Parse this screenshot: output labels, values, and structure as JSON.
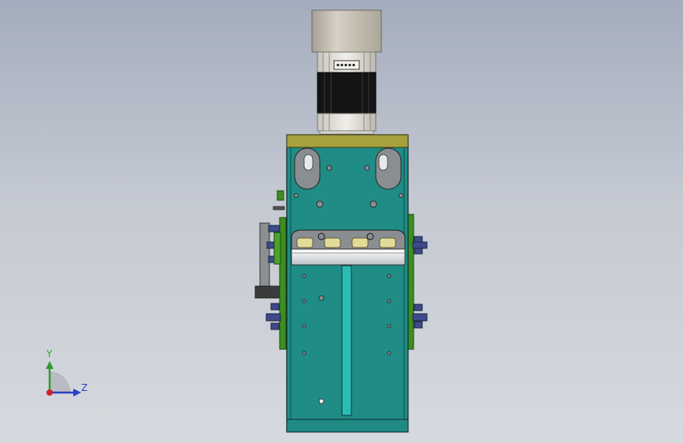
{
  "triad": {
    "y_label": "Y",
    "z_label": "Z",
    "x_color": "#d0202a",
    "y_color": "#2f9b2f",
    "z_color": "#2a3fc8"
  },
  "model": {
    "plate_color": "#208c86",
    "rail_color": "#3d8f1f",
    "top_plate_color": "#a6a13c",
    "motor_cap_color": "#c8c0b4",
    "motor_body_color": "#151515",
    "bearing_color": "#e3db98",
    "slot_color": "#2cbcb4"
  }
}
